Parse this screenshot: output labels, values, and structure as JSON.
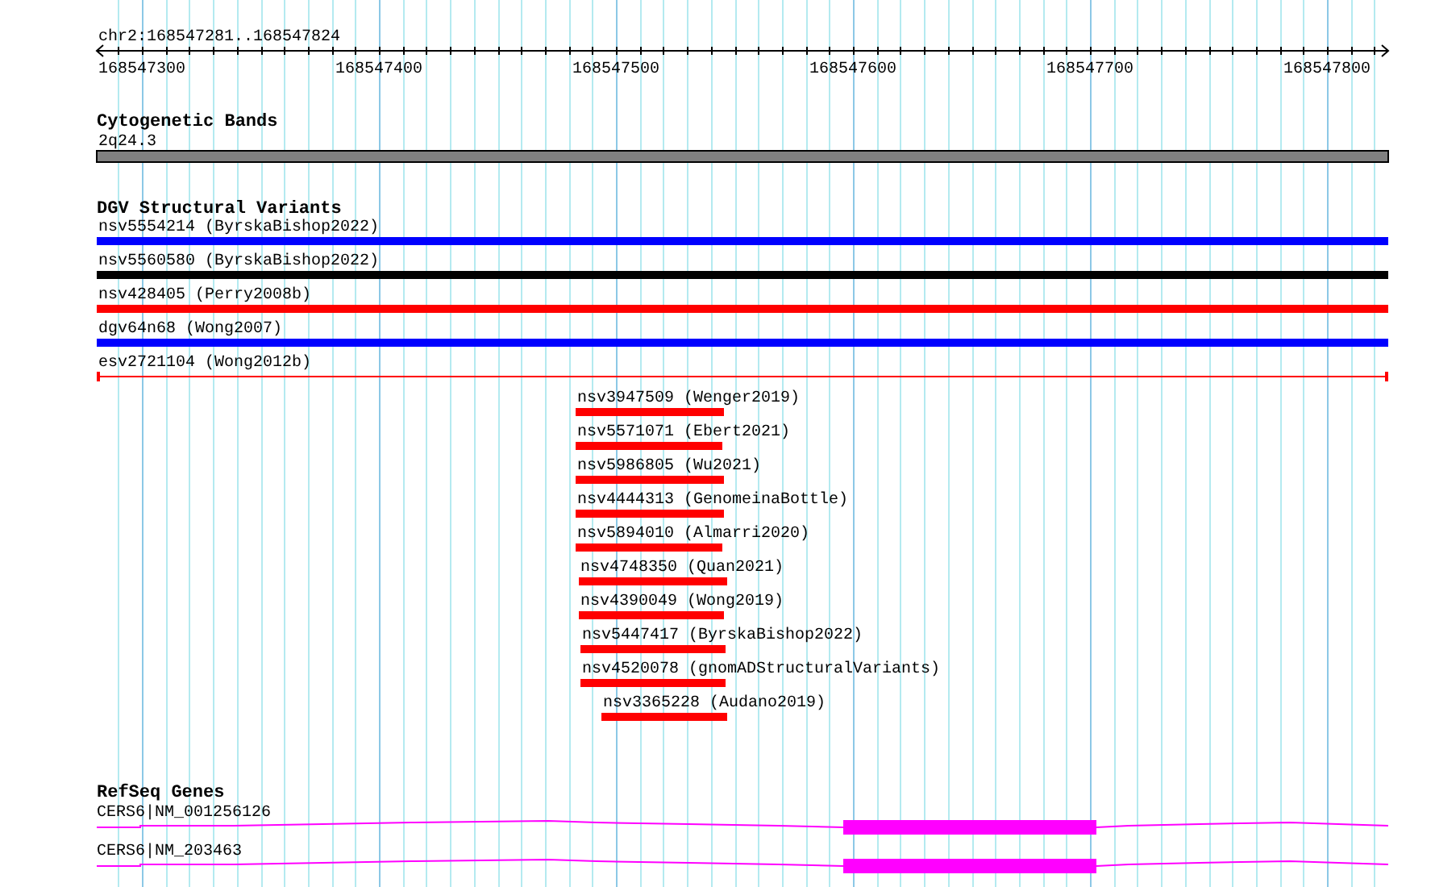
{
  "ruler": {
    "range": "chr2:168547281..168547824",
    "ticks": [
      "168547300",
      "168547400",
      "168547500",
      "168547600",
      "168547700",
      "168547800"
    ]
  },
  "tracks": [
    {
      "title": "Cytogenetic Bands",
      "kind": "band",
      "features": [
        {
          "label": "2q24.3",
          "color": "#808080"
        }
      ]
    },
    {
      "title": "DGV Structural Variants",
      "kind": "variant",
      "features": [
        {
          "label": "nsv5554214 (ByrskaBishop2022)",
          "kind": "bar",
          "color": "#0000ff"
        },
        {
          "label": "nsv5560580 (ByrskaBishop2022)",
          "kind": "bar",
          "color": "#000000"
        },
        {
          "label": "nsv428405 (Perry2008b)",
          "kind": "bar",
          "color": "#ff0000"
        },
        {
          "label": "dgv64n68 (Wong2007)",
          "kind": "bar",
          "color": "#0000ff"
        },
        {
          "label": "esv2721104 (Wong2012b)",
          "kind": "span",
          "color": "#ff0000"
        },
        {
          "label": "nsv3947509 (Wenger2019)",
          "kind": "bar",
          "color": "#ff0000"
        },
        {
          "label": "nsv5571071 (Ebert2021)",
          "kind": "bar",
          "color": "#ff0000"
        },
        {
          "label": "nsv5986805 (Wu2021)",
          "kind": "bar",
          "color": "#ff0000"
        },
        {
          "label": "nsv4444313 (GenomeinaBottle)",
          "kind": "bar",
          "color": "#ff0000"
        },
        {
          "label": "nsv5894010 (Almarri2020)",
          "kind": "bar",
          "color": "#ff0000"
        },
        {
          "label": "nsv4748350 (Quan2021)",
          "kind": "bar",
          "color": "#ff0000"
        },
        {
          "label": "nsv4390049 (Wong2019)",
          "kind": "bar",
          "color": "#ff0000"
        },
        {
          "label": "nsv5447417 (ByrskaBishop2022)",
          "kind": "bar",
          "color": "#ff0000"
        },
        {
          "label": "nsv4520078 (gnomADStructuralVariants)",
          "kind": "bar",
          "color": "#ff0000"
        },
        {
          "label": "nsv3365228 (Audano2019)",
          "kind": "bar",
          "color": "#ff0000"
        }
      ]
    },
    {
      "title": "RefSeq Genes",
      "kind": "gene",
      "features": [
        {
          "label": "CERS6|NM_001256126",
          "color": "#ff00ff"
        },
        {
          "label": "CERS6|NM_203463",
          "color": "#ff00ff"
        }
      ]
    }
  ]
}
